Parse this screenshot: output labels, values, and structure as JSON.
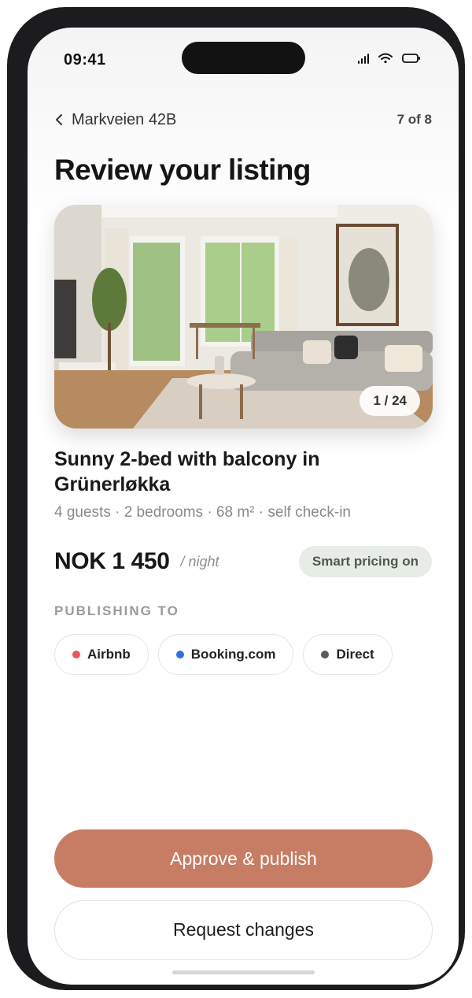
{
  "status_bar": {
    "time": "09:41",
    "icons": [
      "signal-icon",
      "wifi-icon",
      "battery-icon"
    ]
  },
  "header": {
    "back_label": "Markveien 42B",
    "step": "7 of 8"
  },
  "page_title": "Review your listing",
  "photo": {
    "counter": "1 / 24"
  },
  "listing": {
    "title": "Sunny 2-bed with balcony in Grünerløkka",
    "facts": "4 guests · 2 bedrooms · 68 m² · self check-in",
    "price": "NOK 1 450",
    "price_unit": "/ night",
    "smart_pricing": "Smart pricing on"
  },
  "publishing": {
    "label": "PUBLISHING TO",
    "channels": [
      {
        "name": "Airbnb",
        "color": "#e8585a"
      },
      {
        "name": "Booking.com",
        "color": "#2f6fdf"
      },
      {
        "name": "Direct",
        "color": "#5a5a5a"
      }
    ]
  },
  "actions": {
    "approve": "Approve & publish",
    "request": "Request changes"
  },
  "colors": {
    "accent": "#c67d63",
    "smart_chip_bg": "#e7ede6"
  }
}
